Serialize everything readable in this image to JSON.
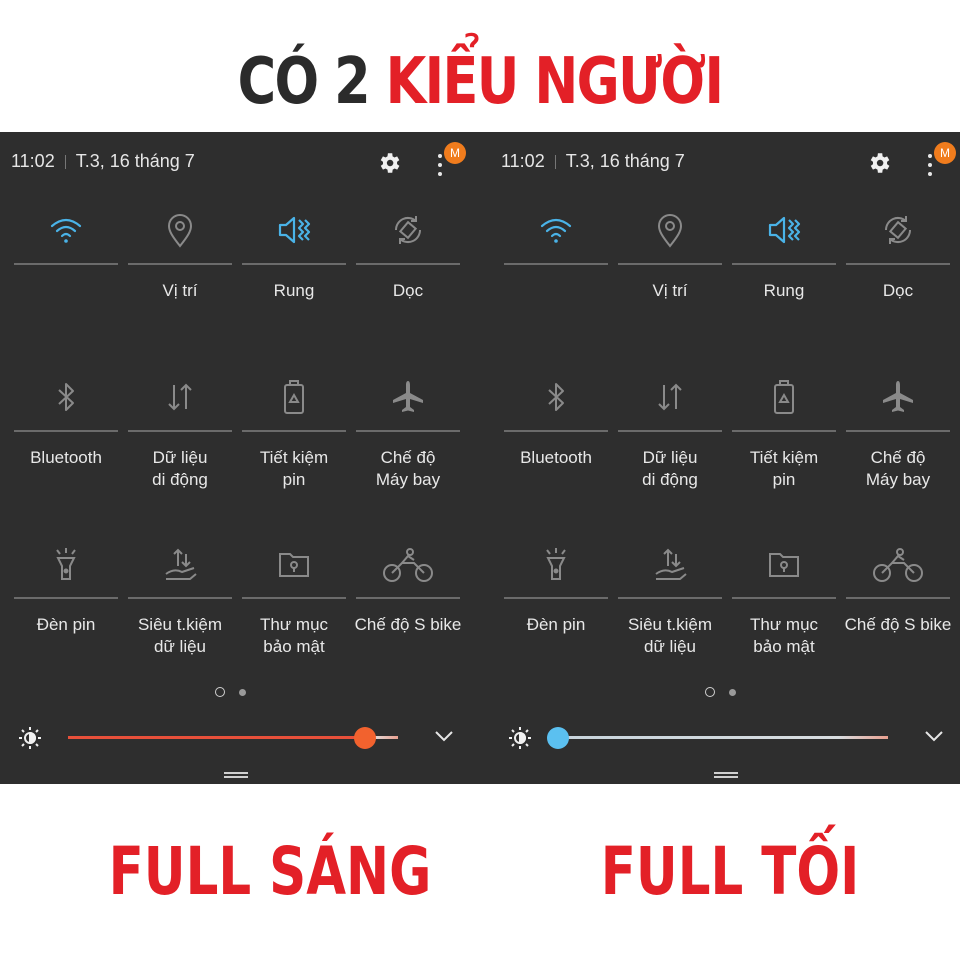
{
  "headline": {
    "part1": "CÓ 2",
    "part2": "KIỂU NGƯỜI"
  },
  "status": {
    "time": "11:02",
    "date": "T.3, 16 tháng 7",
    "badge": "M"
  },
  "tiles": [
    {
      "label": "",
      "icon": "wifi-icon",
      "active": true
    },
    {
      "label": "Vị trí",
      "icon": "location-icon",
      "active": false
    },
    {
      "label": "Rung",
      "icon": "vibrate-icon",
      "active": true
    },
    {
      "label": "Dọc",
      "icon": "rotate-icon",
      "active": false
    },
    {
      "label": "Bluetooth",
      "icon": "bluetooth-icon",
      "active": false
    },
    {
      "label": "Dữ liệu\ndi động",
      "icon": "mobile-data-icon",
      "active": false
    },
    {
      "label": "Tiết kiệm\npin",
      "icon": "battery-saver-icon",
      "active": false
    },
    {
      "label": "Chế độ\nMáy bay",
      "icon": "airplane-icon",
      "active": false
    },
    {
      "label": "Đèn pin",
      "icon": "flashlight-icon",
      "active": false
    },
    {
      "label": "Siêu t.kiệm\ndữ liệu",
      "icon": "data-saver-icon",
      "active": false
    },
    {
      "label": "Thư mục\nbảo mật",
      "icon": "secure-folder-icon",
      "active": false
    },
    {
      "label": "Chế độ S bike",
      "icon": "s-bike-icon",
      "active": false
    }
  ],
  "panels": [
    {
      "brightness": 1.0,
      "thumb_color": "#f2622e",
      "caption": "FULL SÁNG"
    },
    {
      "brightness": 0.0,
      "thumb_color": "#5bc0f0",
      "caption": "FULL TỐI"
    }
  ],
  "colors": {
    "accent_blue": "#4ab3e8",
    "accent_red": "#e32027",
    "panel_bg": "#2e2e2e"
  }
}
